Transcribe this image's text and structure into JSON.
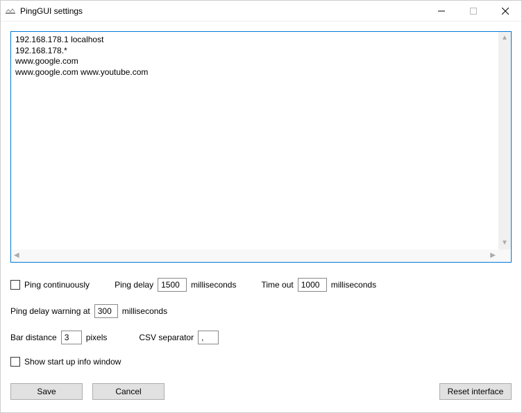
{
  "window": {
    "title": "PingGUI settings"
  },
  "hosts_text": "192.168.178.1 localhost\n192.168.178.*\nwww.google.com\nwww.google.com www.youtube.com",
  "options": {
    "ping_continuously_label": "Ping continuously",
    "ping_delay_label": "Ping delay",
    "ping_delay_value": "1500",
    "ping_delay_unit": "milliseconds",
    "timeout_label": "Time out",
    "timeout_value": "1000",
    "timeout_unit": "milliseconds",
    "ping_delay_warning_label": "Ping delay warning at",
    "ping_delay_warning_value": "300",
    "ping_delay_warning_unit": "milliseconds",
    "bar_distance_label": "Bar distance",
    "bar_distance_value": "3",
    "bar_distance_unit": "pixels",
    "csv_separator_label": "CSV separator",
    "csv_separator_value": ",",
    "show_startup_label": "Show start up info window"
  },
  "buttons": {
    "save": "Save",
    "cancel": "Cancel",
    "reset": "Reset interface"
  }
}
